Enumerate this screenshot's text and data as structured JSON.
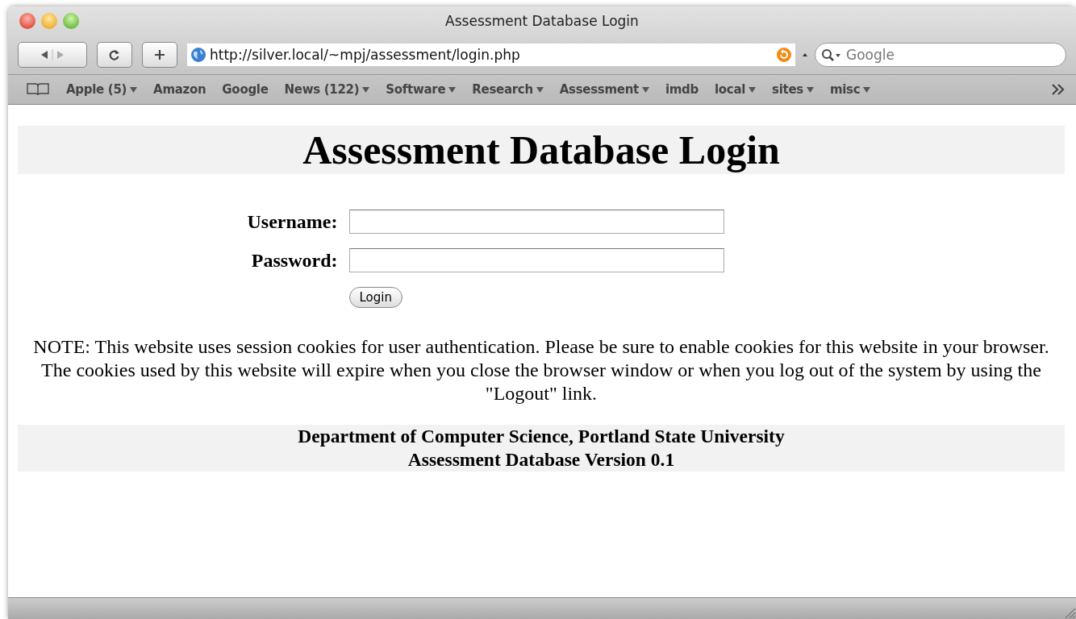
{
  "window": {
    "title": "Assessment Database Login"
  },
  "toolbar": {
    "url": "http://silver.local/~mpj/assessment/login.php",
    "search": {
      "placeholder": "Google"
    }
  },
  "bookmarks": [
    {
      "label": "Apple (5)",
      "has_menu": true
    },
    {
      "label": "Amazon",
      "has_menu": false
    },
    {
      "label": "Google",
      "has_menu": false
    },
    {
      "label": "News (122)",
      "has_menu": true
    },
    {
      "label": "Software",
      "has_menu": true
    },
    {
      "label": "Research",
      "has_menu": true
    },
    {
      "label": "Assessment",
      "has_menu": true
    },
    {
      "label": "imdb",
      "has_menu": false
    },
    {
      "label": "local",
      "has_menu": true
    },
    {
      "label": "sites",
      "has_menu": true
    },
    {
      "label": "misc",
      "has_menu": true
    }
  ],
  "page": {
    "heading": "Assessment Database Login",
    "fields": [
      {
        "label": "Username:"
      },
      {
        "label": "Password:"
      }
    ],
    "button": "Login",
    "note": "NOTE: This website uses session cookies for user authentication. Please be sure to enable cookies for this website in your browser. The cookies used by this website will expire when you close the browser window or when you log out of the system by using the \"Logout\" link.",
    "footer": [
      "Department of Computer Science, Portland State University",
      "Assessment Database Version 0.1"
    ]
  }
}
